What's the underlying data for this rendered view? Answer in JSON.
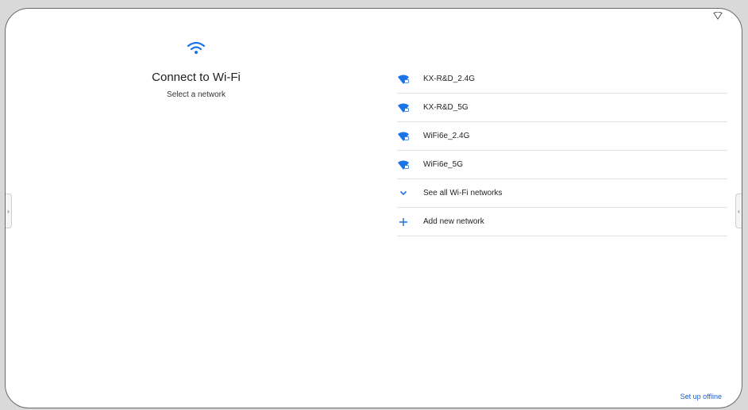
{
  "header": {
    "title": "Connect to Wi-Fi",
    "subtitle": "Select a network"
  },
  "networks": [
    {
      "name": "KX-R&D_2.4G",
      "icon": "wifi-lock-icon"
    },
    {
      "name": "KX-R&D_5G",
      "icon": "wifi-lock-icon"
    },
    {
      "name": "WiFi6e_2.4G",
      "icon": "wifi-lock-icon"
    },
    {
      "name": "WiFi6e_5G",
      "icon": "wifi-lock-icon"
    }
  ],
  "actions": {
    "see_all": "See all Wi-Fi networks",
    "add_network": "Add new network",
    "setup_offline": "Set up offline"
  },
  "handles": {
    "left": "›",
    "right": "‹"
  },
  "colors": {
    "accent": "#1a73e8",
    "link": "#1a5fd0",
    "divider": "#e3e3e3"
  }
}
